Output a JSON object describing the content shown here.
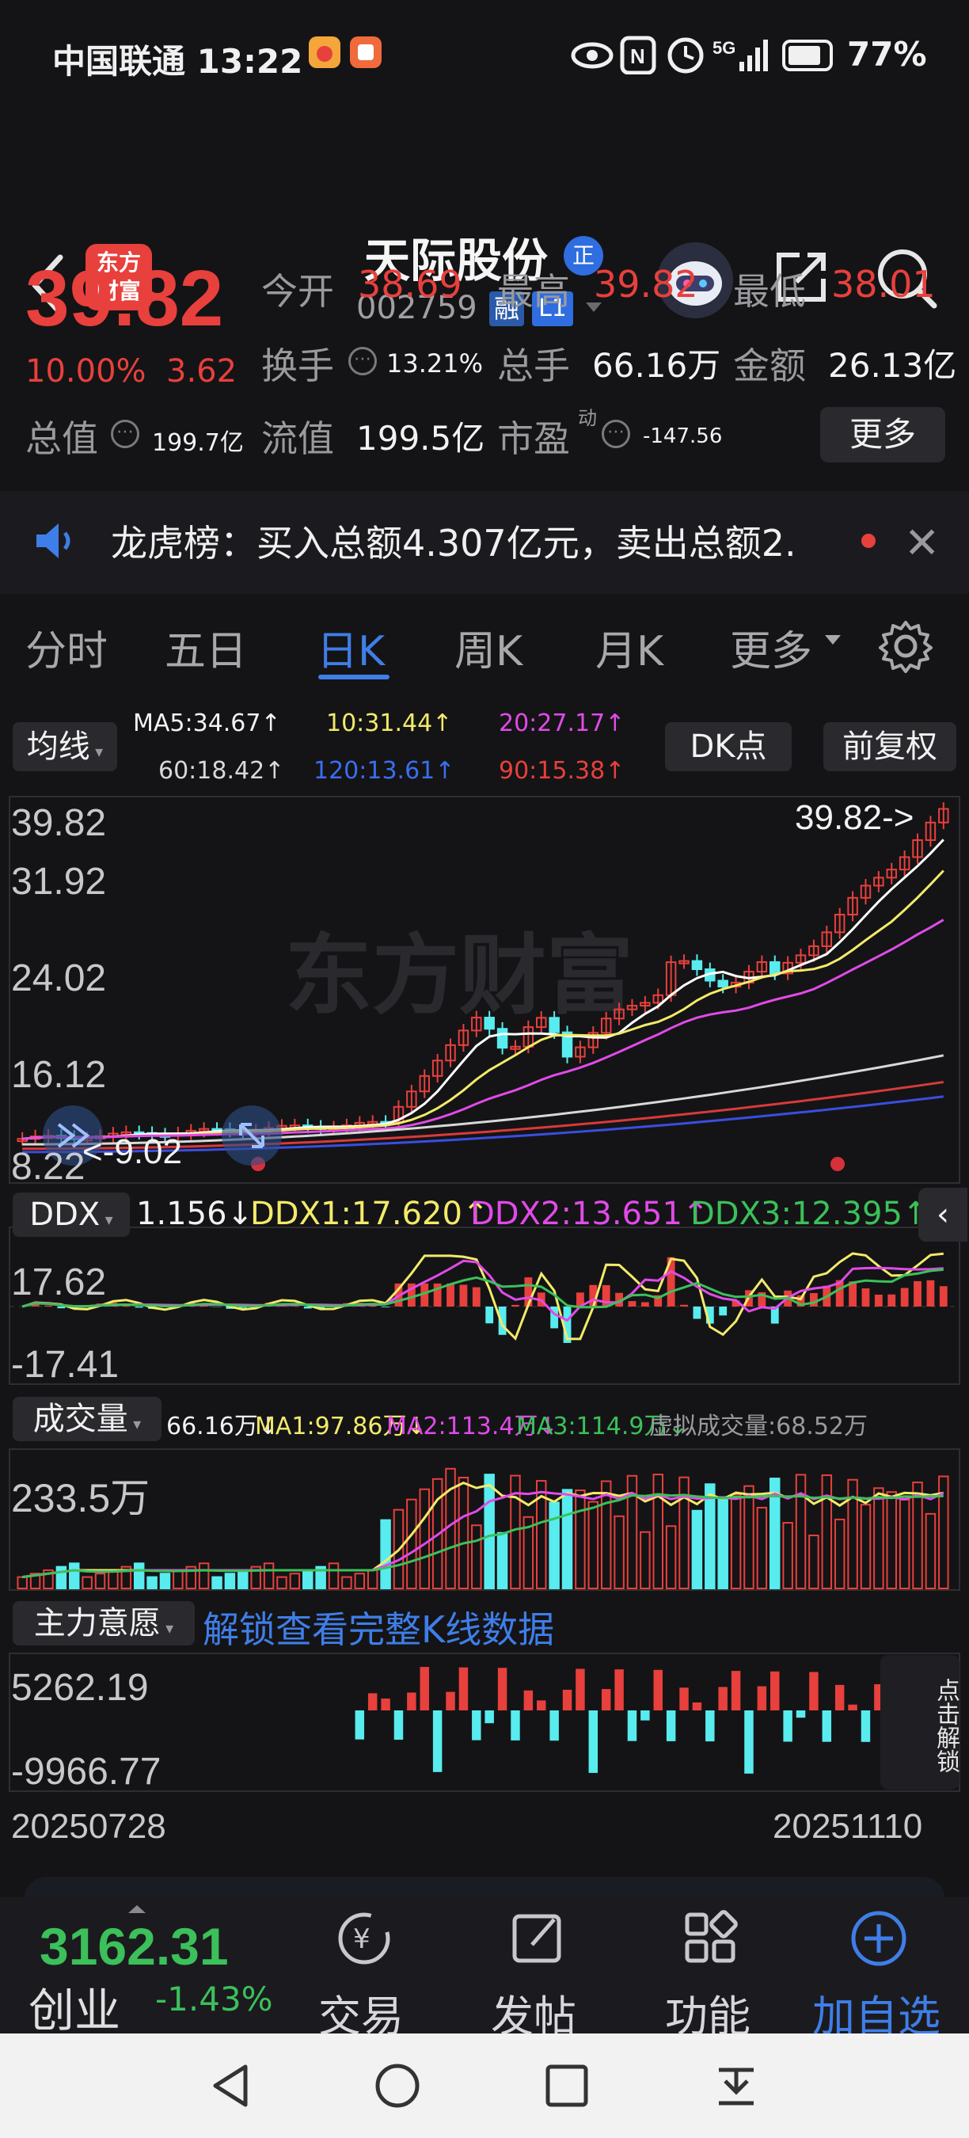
{
  "status_bar": {
    "carrier_time": "中国联通 13:22",
    "battery": "77%"
  },
  "header": {
    "logo_text": "东方\n财富",
    "stock_name": "天际股份",
    "badge_zheng": "正",
    "stock_code": "002759",
    "badge_rong": "融",
    "badge_level": "L1"
  },
  "quote": {
    "price": "39.82",
    "change_pct": "10.00%",
    "change": "3.62",
    "open_label": "今开",
    "open": "38.69",
    "high_label": "最高",
    "high": "39.82",
    "low_label": "最低",
    "low": "38.01",
    "turnover_label": "换手",
    "turnover": "13.21%",
    "volume_label": "总手",
    "volume": "66.16万",
    "amount_label": "金额",
    "amount": "26.13亿",
    "mcap_label": "总值",
    "mcap": "199.7亿",
    "float_label": "流值",
    "float_cap": "199.5亿",
    "pe_label": "市盈",
    "pe_sup": "动",
    "pe": "-147.56",
    "more_button": "更多"
  },
  "news": {
    "text": "龙虎榜：买入总额4.307亿元，卖出总额2."
  },
  "tabs": [
    "分时",
    "五日",
    "日K",
    "周K",
    "月K",
    "更多"
  ],
  "active_tab": "日K",
  "ma_legend": {
    "toggle": "均线",
    "ma5": "MA5:34.67↑",
    "ma10": "10:31.44↑",
    "ma20": "20:27.17↑",
    "ma60": "60:18.42↑",
    "ma120": "120:13.61↑",
    "ma90": "90:15.38↑",
    "dk_button": "DK点",
    "adjust_button": "前复权"
  },
  "kline": {
    "y_labels": [
      "39.82",
      "31.92",
      "24.02",
      "16.12",
      "8.22"
    ],
    "last_price_tag": "39.82->",
    "low_tag": "<-9.02",
    "watermark": "东方财富"
  },
  "ddx": {
    "label": "DDX",
    "value": "1.156↓",
    "ddx1": "DDX1:17.620↑",
    "ddx2": "DDX2:13.651↑",
    "ddx3": "DDX3:12.395↑",
    "y_top": "17.62",
    "y_bottom": "-17.41"
  },
  "volume_panel": {
    "label": "成交量",
    "value": "66.16万↓",
    "ma1": "MA1:97.86万↓",
    "ma2": "MA2:113.4万↓",
    "ma3": "MA3:114.9万↓",
    "virtual": "虚拟成交量:68.52万",
    "y_top": "233.5万"
  },
  "intent_panel": {
    "label": "主力意愿",
    "unlock_link": "解锁查看完整K线数据",
    "y_top": "5262.19",
    "y_bottom": "-9966.77",
    "side_unlock": "点击解锁"
  },
  "dates": {
    "start": "20250728",
    "end": "20251110"
  },
  "bottom_bar": {
    "index_value": "3162.31",
    "index_name": "创业",
    "index_change": "-1.43%",
    "trade": "交易",
    "post": "发帖",
    "functions": "功能",
    "add_watch": "加自选"
  },
  "colors": {
    "up_red": "#e8403c",
    "down_cyan": "#58ecef",
    "accent_blue": "#3f7ee8",
    "ma5_white": "#ffffff",
    "ma10_yellow": "#f3ea6a",
    "ma20_magenta": "#e04be8",
    "ma60_grey": "#d8d8d8",
    "ma90_red": "#d83a3a",
    "ma120_blue": "#3a4ee0",
    "index_green": "#3cc05a"
  }
}
